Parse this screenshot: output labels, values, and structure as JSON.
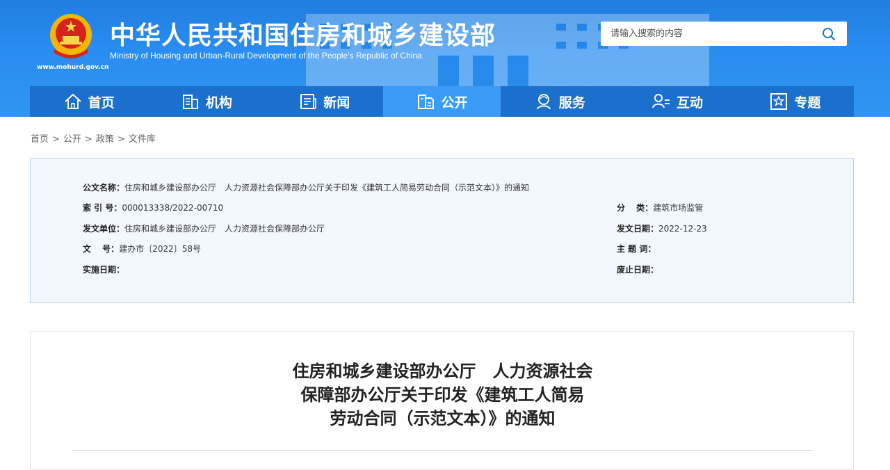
{
  "header": {
    "title_cn": "中华人民共和国住房和城乡建设部",
    "title_en": "Ministry of Housing and Urban-Rural Development of the People’s Republic of China",
    "site_url": "www.mohurd.gov.cn",
    "search_placeholder": "请输入搜索的内容",
    "colors": {
      "header_bg": "#2a8df0",
      "nav_bg": "#1b6fcd",
      "nav_active": "#3a9cf6"
    }
  },
  "nav": {
    "items": [
      {
        "label": "首页",
        "icon": "home-icon"
      },
      {
        "label": "机构",
        "icon": "org-icon"
      },
      {
        "label": "新闻",
        "icon": "news-icon"
      },
      {
        "label": "公开",
        "icon": "public-icon",
        "active": true
      },
      {
        "label": "服务",
        "icon": "service-icon"
      },
      {
        "label": "互动",
        "icon": "interact-icon"
      },
      {
        "label": "专题",
        "icon": "topic-icon"
      }
    ]
  },
  "breadcrumb": [
    "首页",
    "公开",
    "政策",
    "文件库"
  ],
  "breadcrumb_sep": ">",
  "meta": {
    "name_key": "公文名称：",
    "name_val": "住房和城乡建设部办公厅　人力资源社会保障部办公厅关于印发《建筑工人简易劳动合同（示范文本）》的通知",
    "index_key": "索 引 号：",
    "index_val": "000013338/2022-00710",
    "category_key": "分　 类：",
    "category_val": "建筑市场监管",
    "issuer_key": "发文单位：",
    "issuer_val": "住房和城乡建设部办公厅　人力资源社会保障部办公厅",
    "date_key": "发文日期：",
    "date_val": "2022-12-23",
    "docno_key": "文　 号：",
    "docno_val": "建办市〔2022〕58号",
    "subject_key": "主 题 词：",
    "subject_val": "",
    "effective_key": "实施日期：",
    "effective_val": "",
    "abolish_key": "废止日期：",
    "abolish_val": ""
  },
  "article": {
    "title_line1": "住房和城乡建设部办公厅　人力资源社会",
    "title_line2": "保障部办公厅关于印发《建筑工人简易",
    "title_line3": "劳动合同（示范文本）》的通知"
  }
}
